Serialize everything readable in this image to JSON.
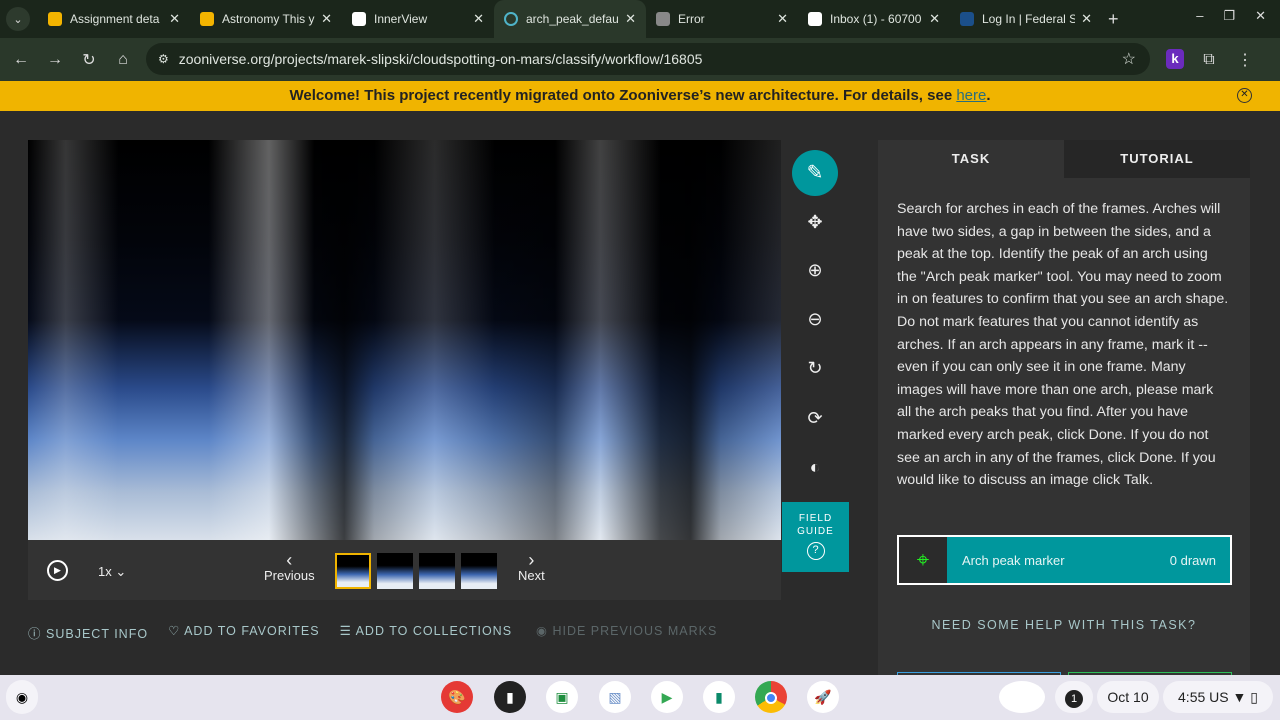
{
  "browser": {
    "tabs": [
      {
        "title": "Assignment deta",
        "color": "#f4b400"
      },
      {
        "title": "Astronomy This y",
        "color": "#f4b400"
      },
      {
        "title": "InnerView",
        "color": "#ffffff"
      },
      {
        "title": "arch_peak_defau",
        "color": "#2a382a"
      },
      {
        "title": "Error",
        "color": "#888888"
      },
      {
        "title": "Inbox (1) - 60700",
        "color": "#ffffff"
      },
      {
        "title": "Log In | Federal S",
        "color": "#1b4f8a"
      }
    ],
    "url": "zooniverse.org/projects/marek-slipski/cloudspotting-on-mars/classify/workflow/16805",
    "extension_label": "k"
  },
  "banner": {
    "text": "Welcome! This project recently migrated onto Zooniverse’s new architecture. For details, see ",
    "link": "here",
    "end": "."
  },
  "viewer": {
    "speed": "1x",
    "previous": "Previous",
    "next": "Next",
    "frames": 4,
    "selected_frame": 1,
    "field_guide": "FIELD GUIDE"
  },
  "meta_actions": {
    "subject_info": "SUBJECT INFO",
    "favorites": "ADD TO FAVORITES",
    "collections": "ADD TO COLLECTIONS",
    "hide_marks": "HIDE PREVIOUS MARKS"
  },
  "panel": {
    "tabs": [
      "TASK",
      "TUTORIAL"
    ],
    "instructions": "Search for arches in each of the frames. Arches will have two sides, a gap in between the sides, and a peak at the top. Identify the peak of an arch using the \"Arch peak marker\" tool. You may need to zoom in on features to confirm that you see an arch shape. Do not mark features that you cannot identify as arches. If an arch appears in any frame, mark it -- even if you can only see it in one frame. Many images will have more than one arch, please mark all the arch peaks that you find. After you have marked every arch peak, click Done. If you do not see an arch in any of the frames, click Done. If you would like to discuss an image click Talk.",
    "tool_name": "Arch peak marker",
    "tool_count": "0 drawn",
    "help": "NEED SOME HELP WITH THIS TASK?"
  },
  "shelf": {
    "notifications": "1",
    "date": "Oct 10",
    "time": "4:55",
    "locale": "US"
  },
  "colors": {
    "accent": "#00979d",
    "banner": "#f0b400"
  }
}
